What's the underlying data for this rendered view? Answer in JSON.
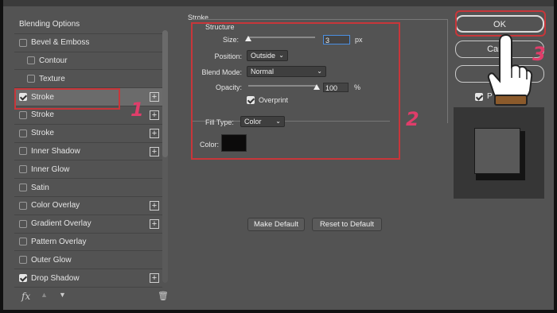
{
  "window": {
    "title": ""
  },
  "style_list": {
    "items": [
      {
        "label": "Blending Options",
        "checkbox": false,
        "checked": false,
        "add": false
      },
      {
        "label": "Bevel & Emboss",
        "checkbox": true,
        "checked": false,
        "add": false
      },
      {
        "label": "Contour",
        "checkbox": true,
        "checked": false,
        "add": false,
        "indent": true
      },
      {
        "label": "Texture",
        "checkbox": true,
        "checked": false,
        "add": false,
        "indent": true
      },
      {
        "label": "Stroke",
        "checkbox": true,
        "checked": true,
        "add": true,
        "selected": true
      },
      {
        "label": "Stroke",
        "checkbox": true,
        "checked": false,
        "add": true
      },
      {
        "label": "Stroke",
        "checkbox": true,
        "checked": false,
        "add": true
      },
      {
        "label": "Inner Shadow",
        "checkbox": true,
        "checked": false,
        "add": true
      },
      {
        "label": "Inner Glow",
        "checkbox": true,
        "checked": false,
        "add": false
      },
      {
        "label": "Satin",
        "checkbox": true,
        "checked": false,
        "add": false
      },
      {
        "label": "Color Overlay",
        "checkbox": true,
        "checked": false,
        "add": true
      },
      {
        "label": "Gradient Overlay",
        "checkbox": true,
        "checked": false,
        "add": true
      },
      {
        "label": "Pattern Overlay",
        "checkbox": true,
        "checked": false,
        "add": false
      },
      {
        "label": "Outer Glow",
        "checkbox": true,
        "checked": false,
        "add": false
      },
      {
        "label": "Drop Shadow",
        "checkbox": true,
        "checked": true,
        "add": true
      }
    ],
    "plus_glyph": "+",
    "fx_label": "fx",
    "up_glyph": "▲",
    "down_glyph": "▼",
    "trash_glyph": "🗑"
  },
  "stroke": {
    "legend": "Stroke",
    "structure": "Structure",
    "size_label": "Size:",
    "size_value": "3",
    "size_unit": "px",
    "position_label": "Position:",
    "position_value": "Outside",
    "blend_label": "Blend Mode:",
    "blend_value": "Normal",
    "opacity_label": "Opacity:",
    "opacity_value": "100",
    "opacity_unit": "%",
    "opacity_fraction": 1.0,
    "size_fraction": 0.0,
    "overprint_label": "Overprint",
    "overprint_checked": true,
    "fill_type_label": "Fill Type:",
    "fill_type_value": "Color",
    "color_label": "Color:",
    "color_swatch": "#0c0b0b",
    "make_default": "Make Default",
    "reset_default": "Reset to Default",
    "chevron": "⌄"
  },
  "buttons": {
    "ok": "OK",
    "cancel": "Cance",
    "new": "New",
    "preview_label": "P"
  },
  "annotations": {
    "badge1": "1",
    "badge2": "2",
    "badge3": "3",
    "color": "#e03d6a"
  }
}
